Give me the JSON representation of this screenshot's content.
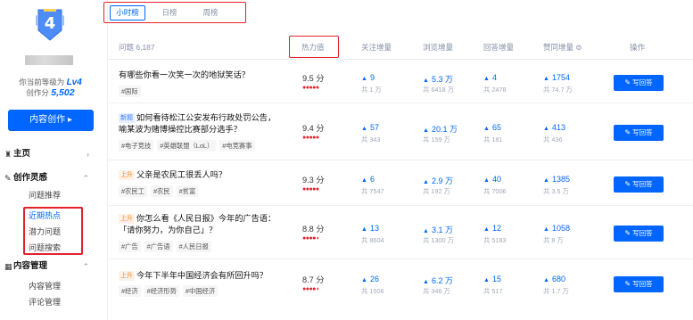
{
  "sidebar": {
    "level_number": "4",
    "level_text_prefix": "你当前等级为",
    "level_value": "Lv4",
    "score_text_prefix": "创作分",
    "score_value": "5,502",
    "create_button": "内容创作 ▸",
    "nav": [
      {
        "label": "主页",
        "icon": "home-icon"
      },
      {
        "label": "创作灵感",
        "icon": "pen-icon"
      },
      {
        "label": "内容管理",
        "icon": "grid-icon"
      }
    ],
    "inspiration_items": [
      "问题推荐",
      "近期热点",
      "潜力问题",
      "问题搜索"
    ],
    "content_items": [
      "内容管理",
      "评论管理"
    ]
  },
  "tabs": [
    "小时榜",
    "日榜",
    "周榜"
  ],
  "table": {
    "headers": {
      "question": "问题 6,187",
      "heat": "热力值",
      "follow": "关注增量",
      "views": "浏览增量",
      "answers": "回答增量",
      "upvotes": "赞同增量 ⊜",
      "action": "操作"
    },
    "answer_button": "写回答",
    "rows": [
      {
        "badge": "",
        "title": "有哪些你看一次笑一次的地狱笑话？",
        "tags": [
          "#国际"
        ],
        "heat": "9.5 分",
        "stars": "●●●●●",
        "follow": "9",
        "follow_total": "共 1 万",
        "views": "5.3 万",
        "views_total": "共 6418 万",
        "answers": "4",
        "answers_total": "共 2478",
        "upvotes": "1754",
        "upvotes_total": "共 74.7 万"
      },
      {
        "badge": "新题",
        "title": "如何看待松江公安发布行政处罚公告，喻某波为赌博操控比赛部分选手？",
        "title_display": "如何看待松江公安发布行政处罚公告，喻某波为赌博操控比赛部分选手？",
        "tags": [
          "#电子竞技",
          "#英雄联盟（LoL）",
          "#电竞赛事"
        ],
        "heat": "9.4 分",
        "stars": "●●●●●",
        "follow": "57",
        "follow_total": "共 343",
        "views": "20.1 万",
        "views_total": "共 159 万",
        "answers": "65",
        "answers_total": "共 181",
        "upvotes": "413",
        "upvotes_total": "共 436"
      },
      {
        "badge": "上升",
        "title": "父亲是农民工很丢人吗？",
        "tags": [
          "#农民工",
          "#农民",
          "#贫富"
        ],
        "heat": "9.3 分",
        "stars": "●●●●●",
        "follow": "6",
        "follow_total": "共 7547",
        "views": "2.9 万",
        "views_total": "共 192 万",
        "answers": "40",
        "answers_total": "共 7006",
        "upvotes": "1385",
        "upvotes_total": "共 3.5 万"
      },
      {
        "badge": "上升",
        "title": "你怎么看《人民日报》今年的广告语：「请你努力，为你自己」？",
        "tags": [
          "#广告",
          "#广告语",
          "#人民日报"
        ],
        "heat": "8.8 分",
        "stars": "●●●●◖",
        "follow": "13",
        "follow_total": "共 8604",
        "views": "3.1 万",
        "views_total": "共 1300 万",
        "answers": "12",
        "answers_total": "共 5183",
        "upvotes": "1058",
        "upvotes_total": "共 8 万"
      },
      {
        "badge": "上升",
        "title": "今年下半年中国经济会有所回升吗？",
        "tags": [
          "#经济",
          "#经济形势",
          "#中国经济"
        ],
        "heat": "8.7 分",
        "stars": "●●●●◖",
        "follow": "26",
        "follow_total": "共 1506",
        "views": "6.2 万",
        "views_total": "共 346 万",
        "answers": "15",
        "answers_total": "共 517",
        "upvotes": "680",
        "upvotes_total": "共 1.7 万"
      }
    ]
  },
  "colors": {
    "accent": "#0066ff",
    "highlight": "#e3222c"
  }
}
